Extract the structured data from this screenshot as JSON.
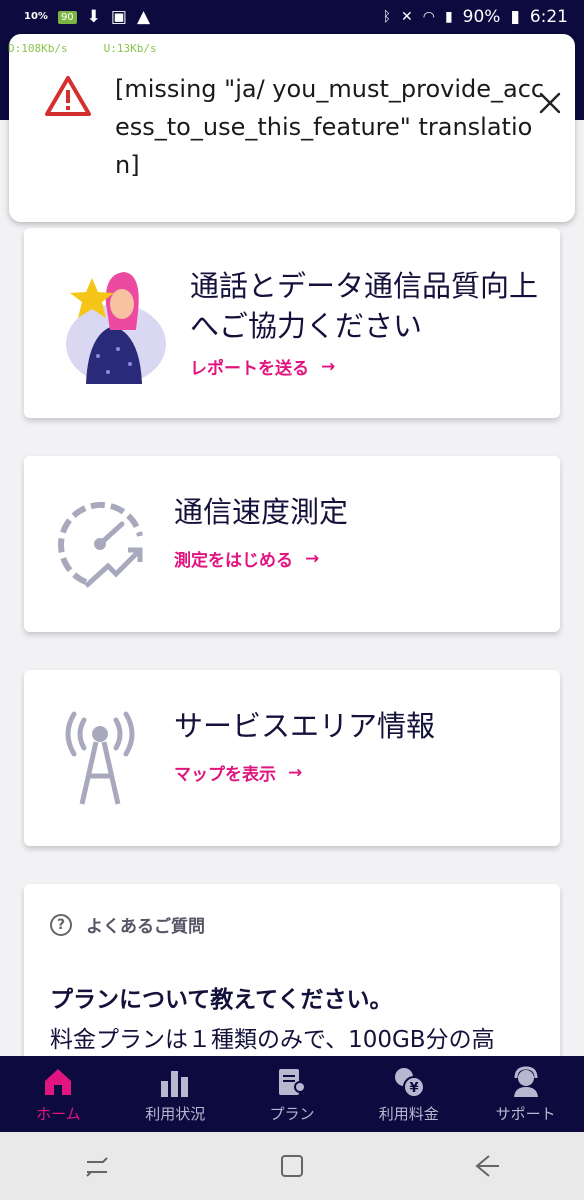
{
  "status_bar": {
    "left_badge": "10%",
    "left_app_badge": "90",
    "battery": "90%",
    "time": "6:21"
  },
  "net_speed": {
    "down": "D:108Kb/s",
    "up": "U:13Kb/s"
  },
  "toast": {
    "message": "[missing \"ja/ you_must_provide_access_to_use_this_feature\" translation]",
    "warning_color": "#d32f2f"
  },
  "cards": {
    "report": {
      "title": "通話とデータ通信品質向上へご協力ください",
      "link": "レポートを送る"
    },
    "speed": {
      "title": "通信速度測定",
      "link": "測定をはじめる"
    },
    "area": {
      "title": "サービスエリア情報",
      "link": "マップを表示"
    },
    "faq": {
      "heading": "よくあるご質問",
      "question": "プランについて教えてください。",
      "answer": "料金プランは１種類のみで、100GB分の高"
    }
  },
  "arrow": "→",
  "bottom_nav": {
    "items": [
      {
        "label": "ホーム",
        "icon": "home-icon",
        "active": true
      },
      {
        "label": "利用状況",
        "icon": "bar-chart-icon",
        "active": false
      },
      {
        "label": "プラン",
        "icon": "plan-icon",
        "active": false
      },
      {
        "label": "利用料金",
        "icon": "yen-coins-icon",
        "active": false
      },
      {
        "label": "サポート",
        "icon": "support-agent-icon",
        "active": false
      }
    ]
  },
  "colors": {
    "brand_navy": "#0c0a3e",
    "accent_pink": "#e0157f",
    "icon_gray": "#a9a9bd"
  }
}
